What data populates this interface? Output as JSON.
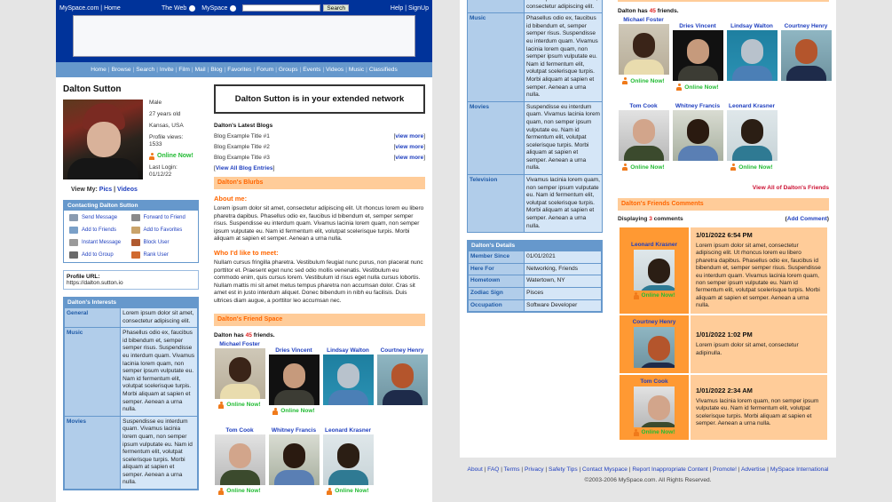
{
  "header": {
    "brand_link": "MySpace.com",
    "home_link": "Home",
    "search_options": [
      "The Web",
      "MySpace"
    ],
    "search_value": "",
    "search_button": "Search",
    "help_link": "Help",
    "signup_link": "SignUp",
    "nav": [
      "Home",
      "Browse",
      "Search",
      "Invite",
      "Film",
      "Mail",
      "Blog",
      "Favorites",
      "Forum",
      "Groups",
      "Events",
      "Videos",
      "Music",
      "Classifieds"
    ]
  },
  "profile": {
    "name": "Dalton Sutton",
    "gender": "Male",
    "age": "27 years old",
    "location": "Kansas, USA",
    "views_label": "Profile views:",
    "views": "1533",
    "online": "Online Now!",
    "last_login_label": "Last Login:",
    "last_login": "01/12/22",
    "view_my": "View My:",
    "pics": "Pics",
    "videos": "Videos"
  },
  "contact": {
    "title": "Contacting Dalton Sutton",
    "items": [
      "Send Message",
      "Forward to Friend",
      "Add to Friends",
      "Add to Favorites",
      "Instant Message",
      "Block User",
      "Add to Group",
      "Rank User"
    ]
  },
  "url": {
    "label": "Profile URL:",
    "value": "https://dalton.sutton.io"
  },
  "interests": {
    "title": "Dalton's Interests",
    "rows": [
      {
        "k": "General",
        "v": "Lorem ipsum dolor sit amet, consectetur adipiscing elit."
      },
      {
        "k": "Music",
        "v": "Phasellus odio ex, faucibus id bibendum et, semper semper risus. Suspendisse eu interdum quam. Vivamus lacinia lorem quam, non semper ipsum vulputate eu. Nam id fermentum elit, volutpat scelerisque turpis. Morbi aliquam at sapien et semper. Aenean a urna nulla."
      },
      {
        "k": "Movies",
        "v": "Suspendisse eu interdum quam. Vivamus lacinia lorem quam, non semper ipsum vulputate eu. Nam id fermentum elit, volutpat scelerisque turpis. Morbi aliquam at sapien et semper. Aenean a urna nulla."
      },
      {
        "k": "Television",
        "v": "Vivamus lacinia lorem quam, non semper ipsum vulputate eu. Nam id fermentum elit, volutpat scelerisque turpis. Morbi aliquam at sapien et semper. Aenean a urna nulla."
      }
    ]
  },
  "details": {
    "title": "Dalton's Details",
    "rows": [
      {
        "k": "Member Since",
        "v": "01/01/2021"
      },
      {
        "k": "Here For",
        "v": "Networking, Friends"
      },
      {
        "k": "Hometown",
        "v": "Watertown, NY"
      },
      {
        "k": "Zodiac Sign",
        "v": "Pisces"
      },
      {
        "k": "Occupation",
        "v": "Software Developer"
      }
    ]
  },
  "network_banner": "Dalton Sutton is in your extended network",
  "blogs": {
    "title": "Dalton's Latest Blogs",
    "entries": [
      "Blog Example Title #1",
      "Blog Example Title #2",
      "Blog Example Title #3"
    ],
    "view_more": "view more",
    "view_all": "View All Blog Entries"
  },
  "blurbs": {
    "title": "Dalton's Blurbs",
    "about_title": "About me:",
    "about": "Lorem ipsum dolor sit amet, consectetur adipiscing elit. Ut rhoncus lorem eu libero pharetra dapibus. Phasellus odio ex, faucibus id bibendum et, semper semper risus. Suspendisse eu interdum quam. Vivamus lacinia lorem quam, non semper ipsum vulputate eu. Nam id fermentum elit, volutpat scelerisque turpis. Morbi aliquam at sapien et semper. Aenean a urna nulla.",
    "meet_title": "Who I'd like to meet:",
    "meet": "Nullam cursus fringilla pharetra. Vestibulum feugiat nunc purus, non placerat nunc porttitor et. Praesent eget nunc sed odio mollis venenatis. Vestibulum eu commodo enim, quis cursus lorem. Vestibulum id risus eget nulla cursus lobortis. Nullam mattis mi sit amet metus tempus pharetra non accumsan dolor. Cras sit amet est in justo interdum aliquet. Donec bibendum in nibh eu facilisis. Duis ultrices diam augue, a porttitor leo accumsan nec."
  },
  "friends": {
    "title": "Dalton's Friend Space",
    "has_prefix": "Dalton has",
    "count": "45",
    "has_suffix": "friends.",
    "list": [
      {
        "name": "Michael Foster",
        "online": "Online Now!"
      },
      {
        "name": "Dries Vincent",
        "online": "Online Now!"
      },
      {
        "name": "Lindsay Walton",
        "online": ""
      },
      {
        "name": "Courtney Henry",
        "online": ""
      },
      {
        "name": "Tom Cook",
        "online": "Online Now!"
      },
      {
        "name": "Whitney Francis",
        "online": ""
      },
      {
        "name": "Leonard Krasner",
        "online": "Online Now!"
      }
    ],
    "view_all": "View All of Dalton's Friends"
  },
  "comments": {
    "title": "Dalton's Friends Comments",
    "displaying_prefix": "Displaying",
    "count": "3",
    "displaying_suffix": "comments",
    "add": "Add Comment",
    "list": [
      {
        "name": "Leonard Krasner",
        "online": "Online Now!",
        "date": "1/01/2022 6:54 PM",
        "text": "Lorem ipsum dolor sit amet, consectetur adipiscing elit. Ut rhoncus lorem eu libero pharetra dapibus. Phasellus odio ex, faucibus id bibendum et, semper semper risus. Suspendisse eu interdum quam. Vivamus lacinia lorem quam, non semper ipsum vulputate eu. Nam id fermentum elit, volutpat scelerisque turpis. Morbi aliquam at sapien et semper. Aenean a urna nulla."
      },
      {
        "name": "Courtney Henry",
        "online": "",
        "date": "1/01/2022 1:02 PM",
        "text": "Lorem ipsum dolor sit amet, consectetur adipinulla."
      },
      {
        "name": "Tom Cook",
        "online": "Online Now!",
        "date": "1/01/2022 2:34 AM",
        "text": "Vivamus lacinia lorem quam, non semper ipsum vulputate eu. Nam id fermentum elit, volutpat scelerisque turpis. Morbi aliquam at sapien et semper. Aenean a urna nulla."
      }
    ]
  },
  "footer": {
    "links": [
      "About",
      "FAQ",
      "Terms",
      "Privacy",
      "Safety Tips",
      "Contact Myspace",
      "Report Inappropriate Content",
      "Promote!",
      "Advertise",
      "MySpace International"
    ],
    "copyright": "©2003-2006 MySpace.com. All Rights Reserved."
  },
  "colors": {
    "header": "#00339a",
    "nav": "#6698cc",
    "accent_orange": "#ff6600",
    "online_green": "#22bb33"
  }
}
